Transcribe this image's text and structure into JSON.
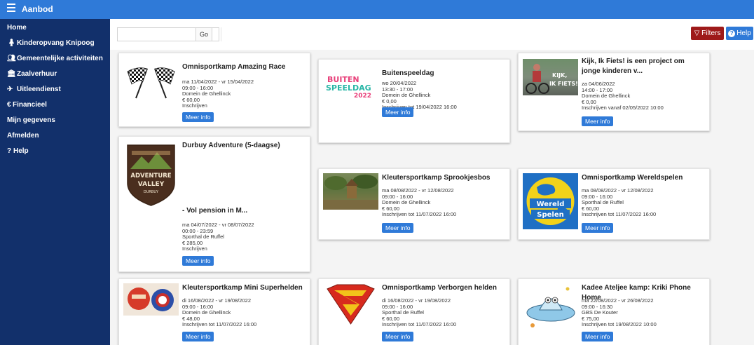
{
  "app": {
    "title": "Aanbod"
  },
  "sidebar": {
    "items": [
      {
        "label": "Home",
        "icon": ""
      },
      {
        "label": "Kinderopvang Knipoog",
        "icon": "person-icon"
      },
      {
        "label": "Gemeentelijke activiteiten",
        "icon": "users-icon"
      },
      {
        "label": "Zaalverhuur",
        "icon": "building-icon"
      },
      {
        "label": "Uitleendienst",
        "icon": "truck-icon"
      },
      {
        "label": "Financieel",
        "icon": "euro-icon"
      },
      {
        "label": "Mijn gegevens",
        "icon": ""
      },
      {
        "label": "Afmelden",
        "icon": ""
      },
      {
        "label": "Help",
        "icon": "question-icon"
      }
    ]
  },
  "toolbar": {
    "search_value": "",
    "go_label": "Go",
    "filters_label": "Filters",
    "help_label": "Help"
  },
  "cards": [
    {
      "title": "Omnisportkamp Amazing Race",
      "info": [
        "ma 11/04/2022 - vr 15/04/2022",
        "09:00 - 16:00",
        "Domein de Ghellinck",
        "€ 60,00",
        "Inschrijven"
      ],
      "button": "Meer info"
    },
    {
      "title": "Buitenspeeldag",
      "info": [
        "wo 20/04/2022",
        "13:30 - 17:00",
        "Domein de Ghellinck",
        "€ 0,00",
        "Inschrijven tot 19/04/2022 16:00"
      ],
      "button": "Meer info"
    },
    {
      "title": "Kijk, Ik Fiets! is een project om jonge kinderen v...",
      "info": [
        "za 04/06/2022",
        "14:00 - 17:00",
        "Domein de Ghellinck",
        "€ 0,00",
        "Inschrijven vanaf 02/05/2022 10:00"
      ],
      "button": "Meer info"
    },
    {
      "title": "Durbuy Adventure (5-daagse)",
      "subtitle": "- Vol pension in M...",
      "info": [
        "ma 04/07/2022 - vr 08/07/2022",
        "00:00 - 23:59",
        "Sporthal de Ruffel",
        "€ 285,00",
        "Inschrijven"
      ],
      "button": "Meer info"
    },
    {
      "title": "Kleutersportkamp Sprookjesbos",
      "info": [
        "ma 08/08/2022 - vr 12/08/2022",
        "09:00 - 16:00",
        "Domein de Ghellinck",
        "€ 60,00",
        "Inschrijven tot 11/07/2022 16:00"
      ],
      "button": "Meer info"
    },
    {
      "title": "Omnisportkamp Wereldspelen",
      "info": [
        "ma 08/08/2022 - vr 12/08/2022",
        "09:00 - 16:00",
        "Sporthal de Ruffel",
        "€ 60,00",
        "Inschrijven tot 11/07/2022 16:00"
      ],
      "button": "Meer info"
    },
    {
      "title": "Kleutersportkamp Mini Superhelden",
      "info": [
        "di 16/08/2022 - vr 19/08/2022",
        "09:00 - 16:00",
        "Domein de Ghellinck",
        "€ 48,00",
        "Inschrijven tot 11/07/2022 16:00"
      ],
      "button": "Meer info"
    },
    {
      "title": "Omnisportkamp Verborgen helden",
      "info": [
        "di 16/08/2022 - vr 19/08/2022",
        "09:00 - 16:00",
        "Sporthal de Ruffel",
        "€ 60,00",
        "Inschrijven tot 11/07/2022 16:00"
      ],
      "button": "Meer info"
    },
    {
      "title": "Kadee Ateljee kamp: Kriki Phone Home",
      "info": [
        "ma 22/08/2022 - vr 26/08/2022",
        "09:00 - 16:30",
        "GBS De Kouter",
        "€ 75,00",
        "Inschrijven tot 19/08/2022 10:00"
      ],
      "button": "Meer info"
    }
  ],
  "logos": {
    "buitenspeeldag": [
      "BUITEN",
      "SPEELDAG",
      "2022"
    ],
    "kijk_fiets": [
      "KIJK,",
      "IK FIETS!"
    ],
    "adventure_valley": [
      "ADVENTURE",
      "VALLEY",
      "DURBUY"
    ],
    "wereld_spelen": [
      "Wereld",
      "Spelen"
    ]
  },
  "colors": {
    "topbar": "#2f7ad8",
    "sidebar": "#12306b",
    "accent": "#2f7ad8",
    "filters": "#9e1a1a"
  }
}
